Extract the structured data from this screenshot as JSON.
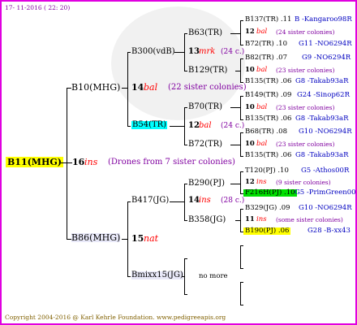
{
  "header": {
    "date": "17- 11-2016 ( 22: 20)"
  },
  "footer": {
    "copyright": "Copyright 2004-2016 @ Karl Kehrle Foundation.   www.pedigreeapis.org"
  },
  "root": {
    "name": "B11(MHG)"
  },
  "gen1": {
    "year": "16",
    "mark": "ins",
    "note": "(Drones from 7 sister colonies)",
    "sire": "B10(MHG)",
    "dam": "B86(MHG)"
  },
  "gen2": {
    "b10": {
      "year": "14",
      "mark": "bal",
      "note": "(22 sister colonies)",
      "sire": "B300(vdB)",
      "dam": "B54(TR)"
    },
    "b86": {
      "year": "15",
      "mark": "nat",
      "sire": "B417(JG)",
      "dam": "Bmixx15(JG)"
    }
  },
  "gen3": {
    "b300": {
      "year": "13",
      "mark": "mrk",
      "note": "(24 c.)",
      "sire": "B63(TR)",
      "dam": "B129(TR)"
    },
    "b54": {
      "year": "12",
      "mark": "bal",
      "note": "(24 c.)",
      "sire": "B70(TR)",
      "dam": "B72(TR)"
    },
    "b417": {
      "year": "14",
      "mark": "ins",
      "note": "(28 c.)",
      "sire": "B290(PJ)",
      "dam": "B358(JG)"
    },
    "bmixx": {
      "nomore": "no more"
    }
  },
  "gen4": [
    {
      "l1": "B137(TR) .11",
      "l1r": "B -Kangaroo98R",
      "year": "12",
      "mark": "bal",
      "note": "(24 sister colonies)",
      "l3": "B72(TR) .10",
      "l3r": "G11 -NO6294R"
    },
    {
      "l1": "B82(TR) .07",
      "l1r": "G9 -NO6294R",
      "year": "10",
      "mark": "bal",
      "note": "(23 sister colonies)",
      "l3": "B135(TR) .06",
      "l3r": "G8 -Takab93aR"
    },
    {
      "l1": "B149(TR) .09",
      "l1r": "G24 -Sinop62R",
      "year": "10",
      "mark": "bal",
      "note": "(23 sister colonies)",
      "l3": "B135(TR) .06",
      "l3r": "G8 -Takab93aR"
    },
    {
      "l1": "B68(TR) .08",
      "l1r": "G10 -NO6294R",
      "year": "10",
      "mark": "bal",
      "note": "(23 sister colonies)",
      "l3": "B135(TR) .06",
      "l3r": "G8 -Takab93aR"
    },
    {
      "l1": "T120(PJ) .10",
      "l1r": "G5 -Athos00R",
      "year": "12",
      "mark": "ins",
      "note": "(9 sister colonies)",
      "l3": "F216H(PJ) .10",
      "l3r": "G5 -PrimGreen00"
    },
    {
      "l1": "B329(JG) .09",
      "l1r": "G10 -NO6294R",
      "year": "11",
      "mark": "ins",
      "note": "(some sister colonies)",
      "l3": "B190(PJ) .06",
      "l3r": "G28 -B-xx43"
    }
  ],
  "colors": {
    "frame": "#e000e0",
    "yellow": "#ffff00",
    "cyan": "#00ffff",
    "green": "#00e000",
    "red": "#ff0000",
    "blue": "#0000c0"
  }
}
